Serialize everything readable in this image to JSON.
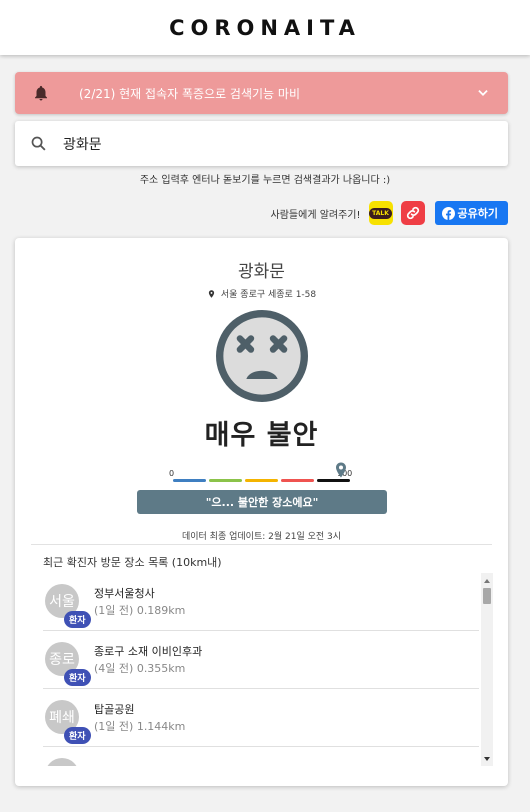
{
  "brand": "CORONAITA",
  "notice": {
    "text": "(2/21) 현재 접속자 폭증으로 검색기능 마비",
    "bell_icon": "bell-icon",
    "chevron_icon": "chevron-down-icon",
    "bg_color": "#ee9a9a"
  },
  "search": {
    "value": "광화문",
    "icon": "search-icon"
  },
  "hint": "주소 입력후 엔터나 돋보기를 누르면 검색결과가 나옵니다 :)",
  "share": {
    "label": "사람들에게 알려주기!",
    "kakao_text": "TALK",
    "facebook_label": "공유하기",
    "facebook_color": "#1877f2",
    "link_color": "#ef3e45",
    "kakao_color": "#f7e100"
  },
  "result": {
    "place": "광화문",
    "address": "서울 종로구 세종로 1-58",
    "face_icon": "dizzy-face-icon",
    "level": "매우 불안",
    "meter": {
      "min_label": "0",
      "max_label": "100",
      "value": 95,
      "segment_colors": [
        "#3f7fc1",
        "#8bc34a",
        "#f4b400",
        "#ef5350",
        "#111111"
      ]
    },
    "message": "\"으... 불안한 장소에요\"",
    "message_color": "#5e7a87",
    "updated": "데이터 최종 업데이트: 2월 21일 오전 3시"
  },
  "list": {
    "title": "최근 확진자 방문 장소 목록 (10km내)",
    "badge_color": "#3f51b5",
    "items": [
      {
        "avatar": "서울",
        "badge": "환자",
        "name": "정부서울청사",
        "meta": "(1일 전) 0.189km"
      },
      {
        "avatar": "종로",
        "badge": "환자",
        "name": "종로구 소재 이비인후과",
        "meta": "(4일 전) 0.355km"
      },
      {
        "avatar": "폐쇄",
        "badge": "환자",
        "name": "탑골공원",
        "meta": "(1일 전) 1.144km"
      },
      {
        "avatar": "",
        "badge": "",
        "name": "",
        "meta": ""
      }
    ]
  }
}
